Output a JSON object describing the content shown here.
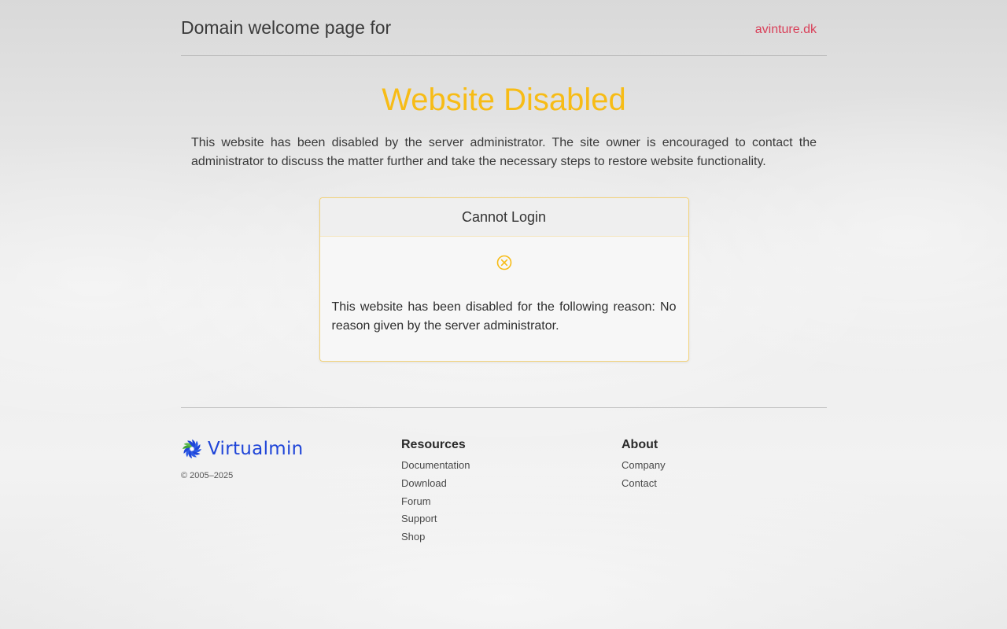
{
  "header": {
    "title": "Domain welcome page for",
    "domain": "avinture.dk"
  },
  "main": {
    "title": "Website Disabled",
    "description": "This website has been disabled by the server administrator. The site owner is encouraged to contact the administrator to discuss the matter further and take the necessary steps to restore website functionality."
  },
  "card": {
    "title": "Cannot Login",
    "icon": "circle-x-icon",
    "message": "This website has been disabled for the following reason: No reason given by the server administrator."
  },
  "footer": {
    "brand": "Virtualmin",
    "copyright": "© 2005–2025",
    "resources": {
      "heading": "Resources",
      "links": [
        "Documentation",
        "Download",
        "Forum",
        "Support",
        "Shop"
      ]
    },
    "about": {
      "heading": "About",
      "links": [
        "Company",
        "Contact"
      ]
    }
  },
  "colors": {
    "accent_title": "#f7bc16",
    "domain_link": "#d9415a",
    "brand_blue": "#1f45d8",
    "card_border": "#f2d27a"
  }
}
